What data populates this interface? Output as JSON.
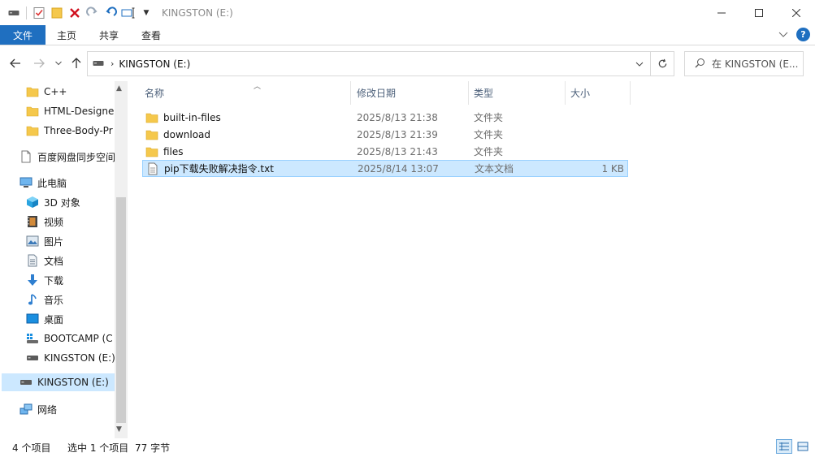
{
  "window": {
    "title": "KINGSTON (E:)",
    "controls": {
      "minimize": "—",
      "maximize": "☐",
      "close": "✕"
    }
  },
  "ribbon": {
    "tabs": [
      "文件",
      "主页",
      "共享",
      "查看"
    ]
  },
  "address": {
    "path": "KINGSTON (E:)",
    "search_placeholder": "在 KINGSTON (E..."
  },
  "nav": {
    "items": [
      {
        "label": "C++",
        "icon": "folder-icon"
      },
      {
        "label": "HTML-Designe",
        "icon": "folder-icon"
      },
      {
        "label": "Three-Body-Pr",
        "icon": "folder-icon"
      },
      {
        "label": "百度网盘同步空间",
        "icon": "cloud-sync-icon"
      },
      {
        "label": "此电脑",
        "icon": "computer-icon"
      },
      {
        "label": "3D 对象",
        "icon": "cube-icon"
      },
      {
        "label": "视频",
        "icon": "video-icon"
      },
      {
        "label": "图片",
        "icon": "picture-icon"
      },
      {
        "label": "文档",
        "icon": "document-icon"
      },
      {
        "label": "下载",
        "icon": "download-icon"
      },
      {
        "label": "音乐",
        "icon": "music-icon"
      },
      {
        "label": "桌面",
        "icon": "desktop-icon"
      },
      {
        "label": "BOOTCAMP (C",
        "icon": "system-drive-icon"
      },
      {
        "label": "KINGSTON (E:)",
        "icon": "usb-drive-icon"
      },
      {
        "label": "KINGSTON (E:)",
        "icon": "usb-drive-icon"
      },
      {
        "label": "网络",
        "icon": "network-icon"
      }
    ]
  },
  "columns": {
    "name": "名称",
    "date": "修改日期",
    "type": "类型",
    "size": "大小"
  },
  "files": [
    {
      "name": "built-in-files",
      "date": "2025/8/13 21:38",
      "type": "文件夹",
      "size": "",
      "icon": "folder-icon"
    },
    {
      "name": "download",
      "date": "2025/8/13 21:39",
      "type": "文件夹",
      "size": "",
      "icon": "folder-icon"
    },
    {
      "name": "files",
      "date": "2025/8/13 21:43",
      "type": "文件夹",
      "size": "",
      "icon": "folder-icon"
    },
    {
      "name": "pip下载失败解决指令.txt",
      "date": "2025/8/14 13:07",
      "type": "文本文档",
      "size": "1 KB",
      "icon": "text-file-icon"
    }
  ],
  "status": {
    "count": "4 个项目",
    "selected": "选中 1 个项目",
    "bytes": "77 字节"
  },
  "colors": {
    "accent": "#1f6fc0",
    "selection": "#cce8ff",
    "selection_border": "#99d1ff",
    "folder": "#f5c84c"
  }
}
